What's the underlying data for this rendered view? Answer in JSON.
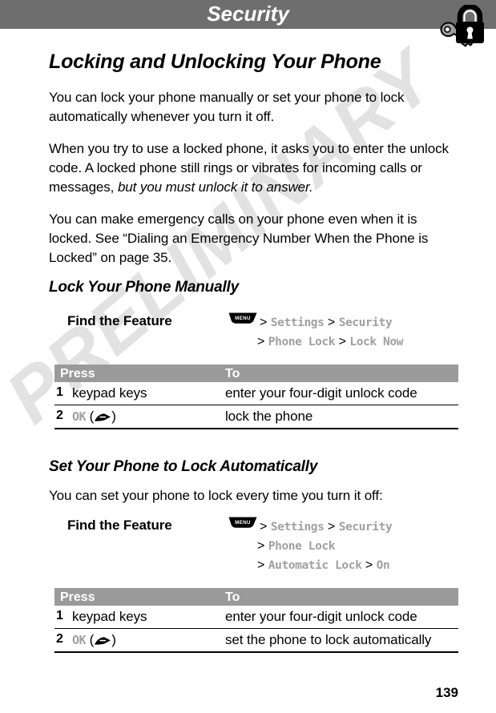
{
  "header": {
    "title": "Security",
    "icon": "lock-and-key-icon",
    "bar_color": "#6e6e6e"
  },
  "watermark": {
    "text": "PRELIMINARY",
    "color": "#e2e2e2"
  },
  "section": {
    "title": "Locking and Unlocking Your Phone",
    "paragraphs": [
      "You can lock your phone manually or set your phone to lock automatically whenever you turn it off.",
      "When you try to use a locked phone, it asks you to enter the unlock code. A locked phone still rings or vibrates for incoming calls or messages, ",
      "You can make emergency calls on your phone even when it is locked. See “Dialing an Emergency Number When the Phone is Locked” on page 35."
    ],
    "paragraph2_italic_tail": "but you must unlock it to answer."
  },
  "sub1": {
    "title": "Lock Your Phone Manually",
    "find_the_feature": {
      "label": "Find the Feature",
      "menu_key": "MENU",
      "lines": [
        [
          {
            "t": "sep",
            "v": ">"
          },
          {
            "t": "item",
            "v": "Settings"
          },
          {
            "t": "sep",
            "v": ">"
          },
          {
            "t": "item",
            "v": "Security"
          }
        ],
        [
          {
            "t": "sep",
            "v": ">"
          },
          {
            "t": "item",
            "v": "Phone Lock"
          },
          {
            "t": "sep",
            "v": ">"
          },
          {
            "t": "item",
            "v": "Lock Now"
          }
        ]
      ]
    },
    "table": {
      "headers": [
        "Press",
        "To"
      ],
      "rows": [
        {
          "num": "1",
          "press": "keypad keys",
          "press_softkey": "",
          "to": "enter your four-digit unlock code"
        },
        {
          "num": "2",
          "press": "",
          "press_softkey": "OK",
          "to": "lock the phone"
        }
      ]
    }
  },
  "sub2": {
    "title": "Set Your Phone to Lock Automatically",
    "intro": "You can set your phone to lock every time you turn it off:",
    "find_the_feature": {
      "label": "Find the Feature",
      "menu_key": "MENU",
      "lines": [
        [
          {
            "t": "sep",
            "v": ">"
          },
          {
            "t": "item",
            "v": "Settings"
          },
          {
            "t": "sep",
            "v": ">"
          },
          {
            "t": "item",
            "v": "Security"
          }
        ],
        [
          {
            "t": "sep",
            "v": ">"
          },
          {
            "t": "item",
            "v": "Phone Lock"
          }
        ],
        [
          {
            "t": "sep",
            "v": ">"
          },
          {
            "t": "item",
            "v": "Automatic Lock"
          },
          {
            "t": "sep",
            "v": ">"
          },
          {
            "t": "item",
            "v": "On"
          }
        ]
      ]
    },
    "table": {
      "headers": [
        "Press",
        "To"
      ],
      "rows": [
        {
          "num": "1",
          "press": "keypad keys",
          "press_softkey": "",
          "to": "enter your four-digit unlock code"
        },
        {
          "num": "2",
          "press": "",
          "press_softkey": "OK",
          "to": "set the phone to lock automatically"
        }
      ]
    }
  },
  "footer": {
    "page_number": "139"
  }
}
